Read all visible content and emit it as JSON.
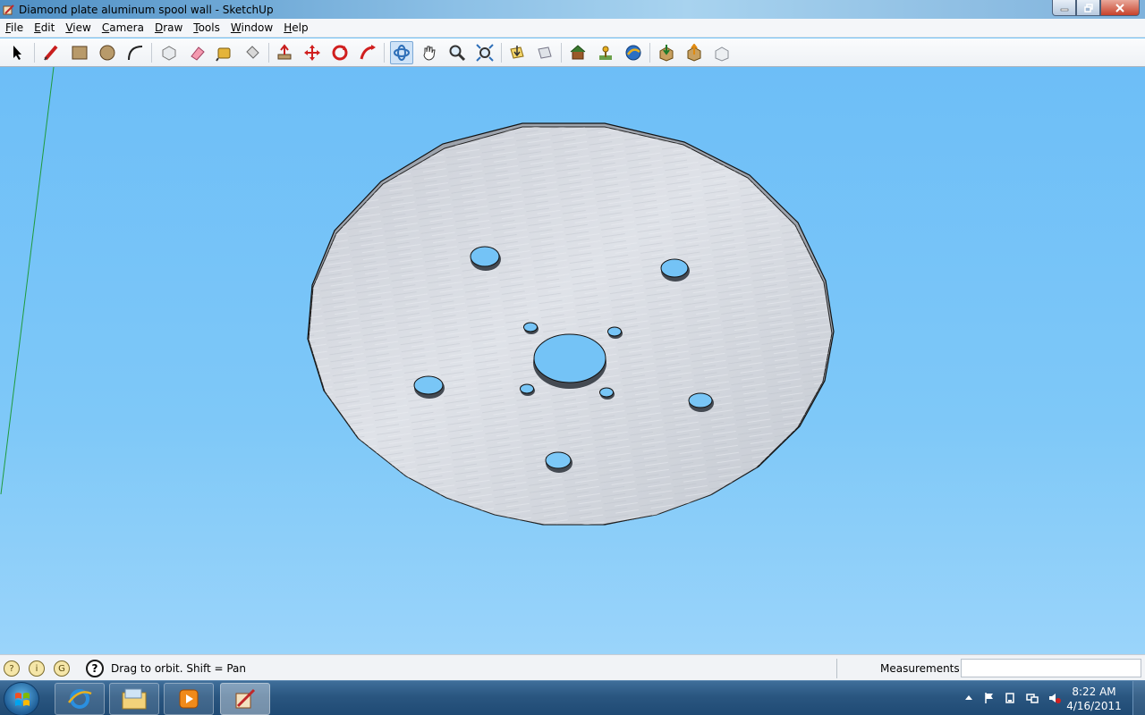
{
  "window": {
    "title": "Diamond plate aluminum spool wall - SketchUp"
  },
  "menu": {
    "items": [
      "File",
      "Edit",
      "View",
      "Camera",
      "Draw",
      "Tools",
      "Window",
      "Help"
    ]
  },
  "toolbar": {
    "tools": [
      "select",
      "pencil",
      "rectangle",
      "circle",
      "arc",
      "make-component",
      "eraser",
      "tape-measure",
      "paint-bucket",
      "push-pull",
      "move",
      "rotate",
      "follow-me",
      "orbit",
      "pan",
      "zoom",
      "zoom-extents",
      "previous-view",
      "next-view",
      "get-models",
      "add-location",
      "google-earth",
      "get-models-share",
      "share-model",
      "share-component"
    ],
    "active_tool": "orbit"
  },
  "status": {
    "hint": "Drag to orbit.  Shift = Pan",
    "measurements_label": "Measurements",
    "measurements_value": ""
  },
  "taskbar": {
    "time": "8:22 AM",
    "date": "4/16/2011",
    "apps": [
      "internet-explorer",
      "windows-explorer",
      "media-player",
      "sketchup"
    ]
  },
  "colors": {
    "sky": "#6fc1f6",
    "plate": "#d3d7dd",
    "hole": "#6fc1f6"
  }
}
